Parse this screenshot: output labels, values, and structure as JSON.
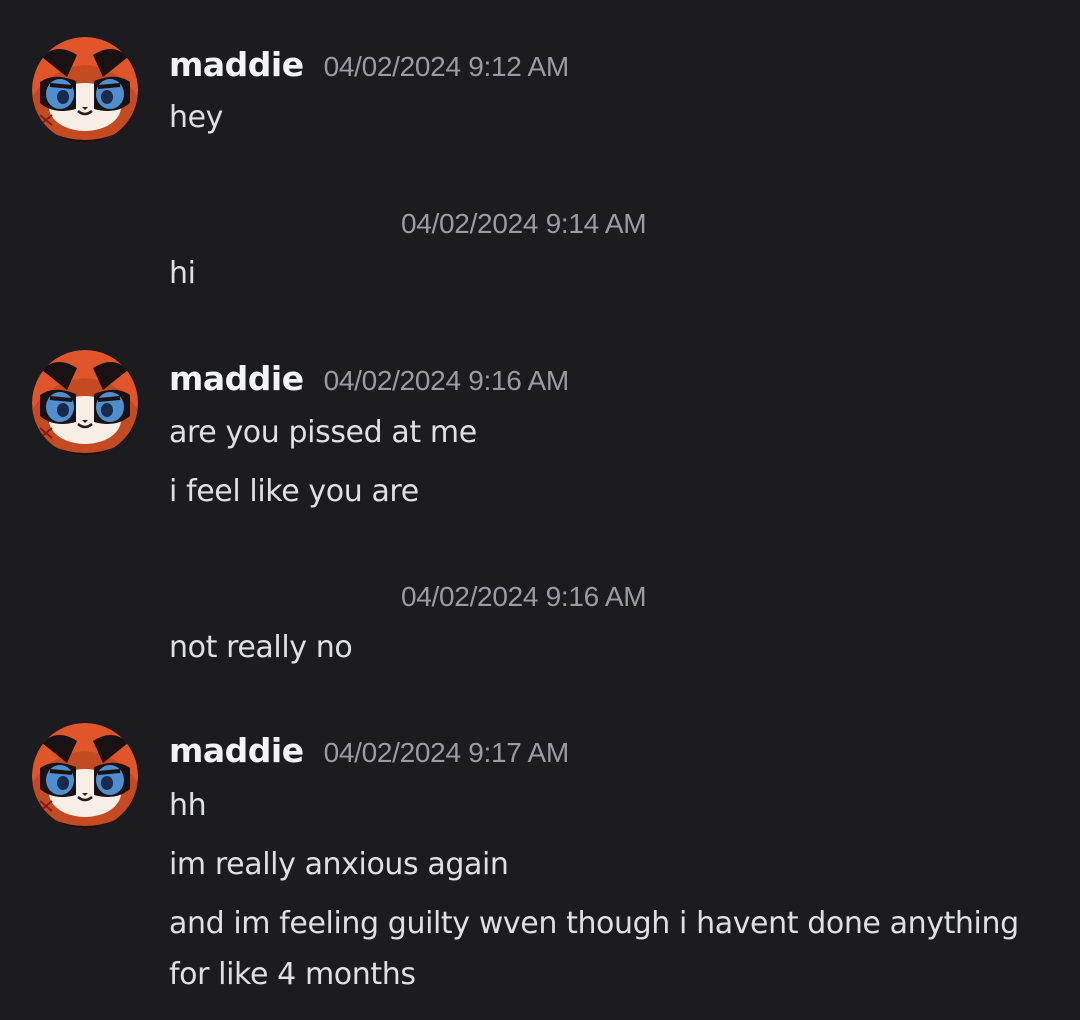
{
  "messages": [
    {
      "author": "maddie",
      "timestamp": "04/02/2024 9:12 AM",
      "lines": [
        "hey"
      ]
    },
    {
      "timestamp": "04/02/2024 9:14 AM",
      "lines": [
        "hi"
      ]
    },
    {
      "author": "maddie",
      "timestamp": "04/02/2024 9:16 AM",
      "lines": [
        "are you pissed at me",
        "i feel like you are"
      ]
    },
    {
      "timestamp": "04/02/2024 9:16 AM",
      "lines": [
        "not really no"
      ]
    },
    {
      "author": "maddie",
      "timestamp": "04/02/2024 9:17 AM",
      "lines": [
        "hh",
        "im really anxious again",
        "and im feeling guilty wven though i havent done anything",
        "for like 4 months"
      ]
    }
  ],
  "colors": {
    "background": "#1b1b20",
    "username": "#f2f3f5",
    "timestamp": "#9a9ba3",
    "message_text": "#dfe0e4",
    "avatar_fur": "#e0562a"
  },
  "avatar_icon": "red-panda-avatar-icon"
}
